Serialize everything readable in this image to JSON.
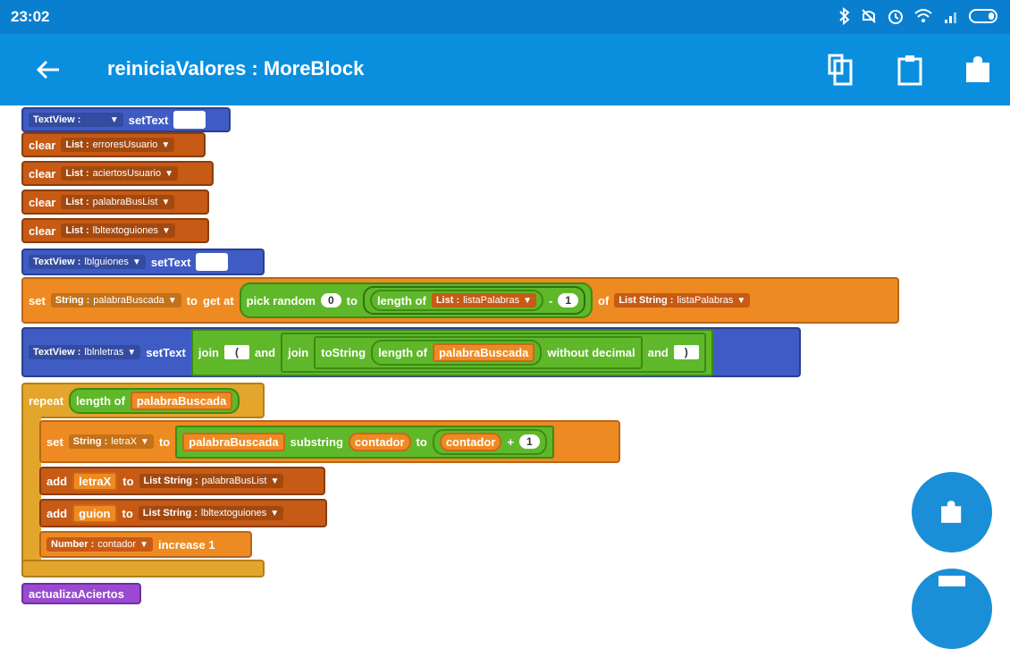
{
  "status": {
    "time": "23:02"
  },
  "appbar": {
    "title": "reiniciaValores : MoreBlock"
  },
  "icons": {
    "back": "back-arrow-icon",
    "copy": "copy-icon",
    "clipboard": "clipboard-icon",
    "puzzle": "puzzle-icon"
  },
  "blocks": {
    "b1": {
      "type": "TextView :",
      "action": "setText"
    },
    "b2": {
      "kw": "clear",
      "listlabel": "List :",
      "name": "erroresUsuario"
    },
    "b3": {
      "kw": "clear",
      "listlabel": "List :",
      "name": "aciertosUsuario"
    },
    "b4": {
      "kw": "clear",
      "listlabel": "List :",
      "name": "palabraBusList"
    },
    "b5": {
      "kw": "clear",
      "listlabel": "List :",
      "name": "lbltextoguiones"
    },
    "b6": {
      "type": "TextView :",
      "name": "lblguiones",
      "action": "setText"
    },
    "b7": {
      "kw": "set",
      "strlabel": "String :",
      "name": "palabraBuscada",
      "to": "to",
      "getat": "get at",
      "pick": "pick random",
      "zero": "0",
      "to2": "to",
      "lengthof": "length of",
      "listlabel": "List :",
      "listname": "listaPalabras",
      "minus": "-",
      "one": "1",
      "of": "of",
      "lslabel": "List String :",
      "lsname": "listaPalabras"
    },
    "b8": {
      "type": "TextView :",
      "name": "lblnletras",
      "action": "setText",
      "join": "join",
      "paren": "(",
      "and": "and",
      "join2": "join",
      "tostring": "toString",
      "lengthof": "length of",
      "var": "palabraBuscada",
      "without": "without decimal",
      "and2": "and",
      "close": ")"
    },
    "b9": {
      "kw": "repeat",
      "lengthof": "length of",
      "var": "palabraBuscada"
    },
    "b10": {
      "kw": "set",
      "strlabel": "String :",
      "name": "letraX",
      "to": "to",
      "var": "palabraBuscada",
      "substring": "substring",
      "v2": "contador",
      "to2": "to",
      "v3": "contador",
      "plus": "+",
      "one": "1"
    },
    "b11": {
      "kw": "add",
      "var": "letraX",
      "to": "to",
      "lslabel": "List String :",
      "name": "palabraBusList"
    },
    "b12": {
      "kw": "add",
      "var": "guion",
      "to": "to",
      "lslabel": "List String :",
      "name": "lbltextoguiones"
    },
    "b13": {
      "numlabel": "Number :",
      "name": "contador",
      "action": "increase 1"
    },
    "b14": {
      "name": "actualizaAciertos"
    }
  }
}
